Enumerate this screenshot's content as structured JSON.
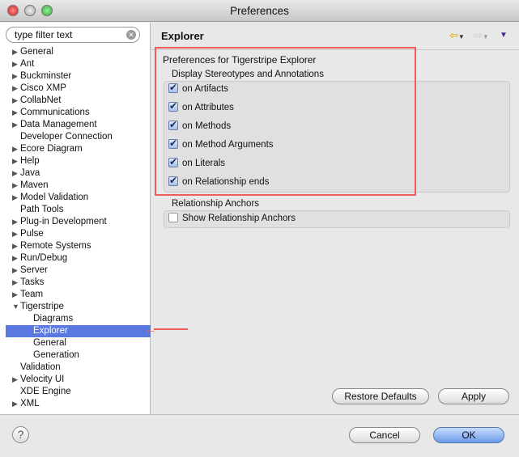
{
  "window": {
    "title": "Preferences"
  },
  "sidebar": {
    "filter_placeholder": "type filter text",
    "items": [
      {
        "label": "General",
        "arrow": "right",
        "level": 0
      },
      {
        "label": "Ant",
        "arrow": "right",
        "level": 0
      },
      {
        "label": "Buckminster",
        "arrow": "right",
        "level": 0
      },
      {
        "label": "Cisco XMP",
        "arrow": "right",
        "level": 0
      },
      {
        "label": "CollabNet",
        "arrow": "right",
        "level": 0
      },
      {
        "label": "Communications",
        "arrow": "right",
        "level": 0
      },
      {
        "label": "Data Management",
        "arrow": "right",
        "level": 0
      },
      {
        "label": "Developer Connection",
        "arrow": "",
        "level": 0
      },
      {
        "label": "Ecore Diagram",
        "arrow": "right",
        "level": 0
      },
      {
        "label": "Help",
        "arrow": "right",
        "level": 0
      },
      {
        "label": "Java",
        "arrow": "right",
        "level": 0
      },
      {
        "label": "Maven",
        "arrow": "right",
        "level": 0
      },
      {
        "label": "Model Validation",
        "arrow": "right",
        "level": 0
      },
      {
        "label": "Path Tools",
        "arrow": "",
        "level": 0
      },
      {
        "label": "Plug-in Development",
        "arrow": "right",
        "level": 0
      },
      {
        "label": "Pulse",
        "arrow": "right",
        "level": 0
      },
      {
        "label": "Remote Systems",
        "arrow": "right",
        "level": 0
      },
      {
        "label": "Run/Debug",
        "arrow": "right",
        "level": 0
      },
      {
        "label": "Server",
        "arrow": "right",
        "level": 0
      },
      {
        "label": "Tasks",
        "arrow": "right",
        "level": 0
      },
      {
        "label": "Team",
        "arrow": "right",
        "level": 0
      },
      {
        "label": "Tigerstripe",
        "arrow": "down",
        "level": 0
      },
      {
        "label": "Diagrams",
        "arrow": "",
        "level": 1
      },
      {
        "label": "Explorer",
        "arrow": "",
        "level": 1,
        "selected": true
      },
      {
        "label": "General",
        "arrow": "",
        "level": 1
      },
      {
        "label": "Generation",
        "arrow": "",
        "level": 1
      },
      {
        "label": "Validation",
        "arrow": "",
        "level": 0
      },
      {
        "label": "Velocity UI",
        "arrow": "right",
        "level": 0
      },
      {
        "label": "XDE Engine",
        "arrow": "",
        "level": 0
      },
      {
        "label": "XML",
        "arrow": "right",
        "level": 0
      }
    ]
  },
  "main": {
    "title": "Explorer",
    "section_title": "Preferences for Tigerstripe Explorer",
    "group1": {
      "label": "Display Stereotypes and Annotations",
      "options": [
        {
          "label": "on Artifacts",
          "checked": true
        },
        {
          "label": "on Attributes",
          "checked": true
        },
        {
          "label": "on Methods",
          "checked": true
        },
        {
          "label": "on Method Arguments",
          "checked": true
        },
        {
          "label": "on Literals",
          "checked": true
        },
        {
          "label": "on Relationship ends",
          "checked": true
        }
      ]
    },
    "group2": {
      "label": "Relationship Anchors",
      "options": [
        {
          "label": "Show Relationship Anchors",
          "checked": false
        }
      ]
    },
    "restore_label": "Restore Defaults",
    "apply_label": "Apply"
  },
  "footer": {
    "cancel_label": "Cancel",
    "ok_label": "OK",
    "help_icon": "?"
  },
  "colors": {
    "selection": "#5a78e0",
    "annotation": "#ef5a5a"
  }
}
